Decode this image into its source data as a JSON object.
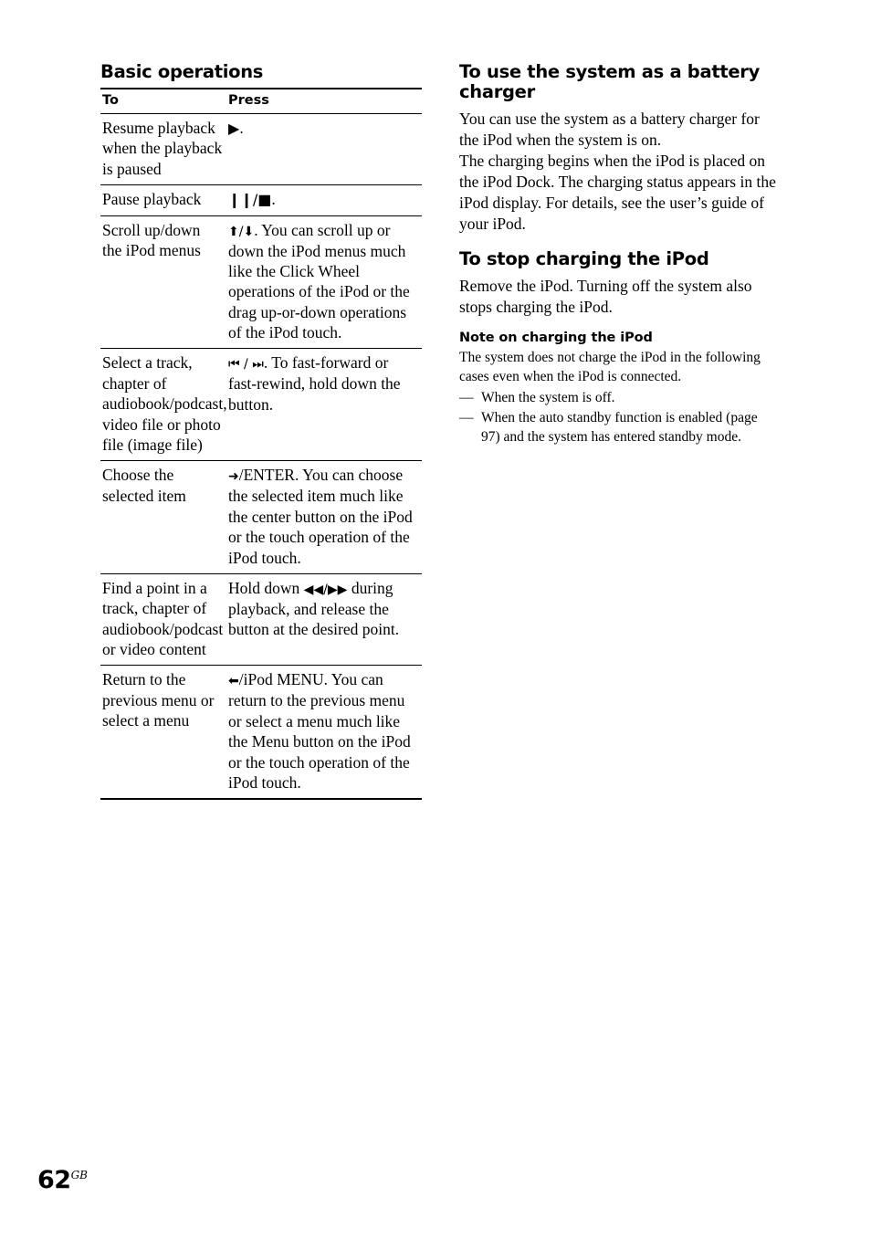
{
  "left_column": {
    "section_title": "Basic operations",
    "table": {
      "headers": [
        "To",
        "Press"
      ],
      "rows": [
        {
          "to": "Resume playback when the playback is paused",
          "press_glyph": "▶",
          "press": "."
        },
        {
          "to": "Pause playback",
          "press_glyph": "❙❙/■",
          "press": "."
        },
        {
          "to": "Scroll up/down the iPod menus",
          "press_glyph": "⬆/⬇",
          "press": ". You can scroll up or down the iPod menus much like the Click Wheel operations of the iPod or the drag up-or-down operations of the iPod touch."
        },
        {
          "to": "Select a track, chapter of audiobook/podcast, video file or photo file (image file)",
          "press_glyph": "⏮ / ⏭",
          "press": ". To fast-forward or fast-rewind, hold down the button."
        },
        {
          "to": "Choose the selected item",
          "press_glyph": "➜",
          "press": "/ENTER. You can choose the selected item much like the center button on the iPod or the touch operation of the iPod touch."
        },
        {
          "to": "Find a point in a track, chapter of audiobook/podcast or video content",
          "press_prefix": "Hold down ",
          "press_glyph": "◀◀/▶▶",
          "press": " during playback, and release the button at the desired point."
        },
        {
          "to": "Return to the previous menu or select a menu",
          "press_glyph": "⬅",
          "press": "/iPod MENU. You can return to the previous menu or select a menu much like the Menu button on the iPod or the touch operation of the iPod touch."
        }
      ]
    }
  },
  "right_column": {
    "section_title": "To use the system as a battery charger",
    "paragraph_1": "You can use the system as a battery charger for the iPod when the system is on.",
    "paragraph_2": "The charging begins when the iPod is placed on the iPod Dock. The charging status appears in the iPod display. For details, see the user’s guide of your iPod.",
    "section_title_2": "To stop charging the iPod",
    "paragraph_3": "Remove the iPod. Turning off the system also stops charging the iPod.",
    "note_title": "Note on charging the iPod",
    "note_body": "The system does not charge the iPod in the following cases even when the iPod is connected.",
    "note_items": [
      "When the system is off.",
      "When the auto standby function is enabled (page 97) and the system has entered standby mode."
    ],
    "dash": "—"
  },
  "footer": {
    "page_number": "62",
    "page_suffix": "GB"
  }
}
